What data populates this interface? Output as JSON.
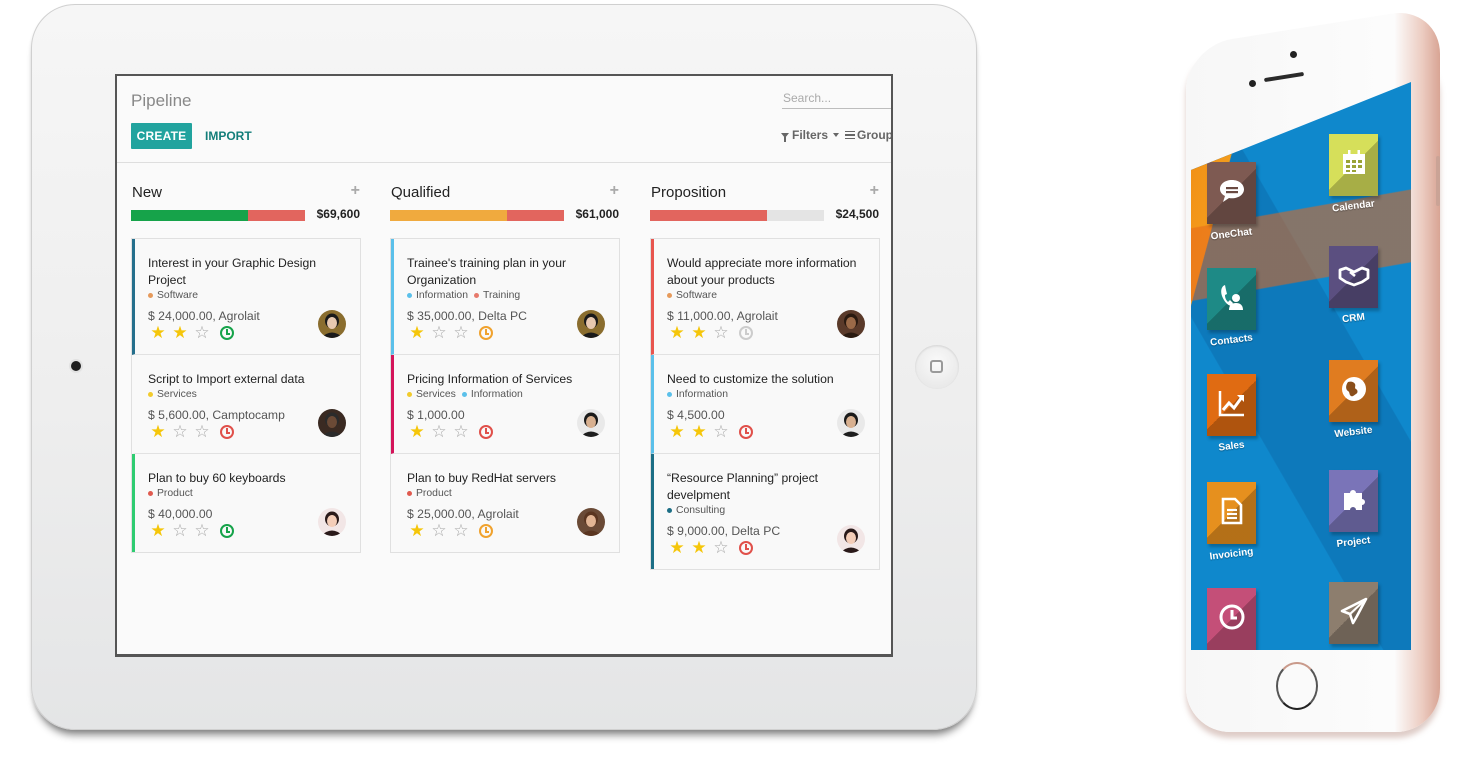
{
  "tablet": {
    "page_title": "Pipeline",
    "create_label": "CREATE",
    "import_label": "IMPORT",
    "search_placeholder": "Search...",
    "filters_label": "Filters",
    "group_label": "Group",
    "colors": {
      "accent": "#21a39e",
      "accent_dark": "#137e7a"
    },
    "columns": [
      {
        "title": "New",
        "total": "$69,600",
        "progress": [
          {
            "color": "#16a34a",
            "fraction": 0.67
          },
          {
            "color": "#e2655e",
            "fraction": 0.33
          }
        ],
        "cards": [
          {
            "title": "Interest in your Graphic Design Project",
            "tags": [
              {
                "label": "Software",
                "color": "#e69a5b"
              }
            ],
            "amount": "$ 24,000.00, Agrolait",
            "stars": 2,
            "activity_color": "#16a34a",
            "border_color": "#256f8c",
            "avatar": "woman-dark-hair"
          },
          {
            "title": "Script to Import external data",
            "tags": [
              {
                "label": "Services",
                "color": "#f2cb2c"
              }
            ],
            "amount": "$ 5,600.00, Camptocamp",
            "stars": 1,
            "activity_color": "#e0504a",
            "border_color": "transparent",
            "avatar": "man-bald"
          },
          {
            "title": "Plan to buy 60 keyboards",
            "tags": [
              {
                "label": "Product",
                "color": "#e05a4f"
              }
            ],
            "amount": "$ 40,000.00",
            "stars": 1,
            "activity_color": "#16a34a",
            "border_color": "#2ecc71",
            "avatar": "woman-cartoon"
          }
        ]
      },
      {
        "title": "Qualified",
        "total": "$61,000",
        "progress": [
          {
            "color": "#f0aa3e",
            "fraction": 0.67
          },
          {
            "color": "#e2655e",
            "fraction": 0.33
          }
        ],
        "cards": [
          {
            "title": "Trainee's training plan in your Organization",
            "tags": [
              {
                "label": "Information",
                "color": "#5bc0ea"
              },
              {
                "label": "Training",
                "color": "#e77a6c"
              }
            ],
            "amount": "$ 35,000.00, Delta PC",
            "stars": 1,
            "activity_color": "#f0a22e",
            "border_color": "#5bc0ea",
            "avatar": "woman-dark-hair"
          },
          {
            "title": "Pricing Information of Services",
            "tags": [
              {
                "label": "Services",
                "color": "#f2cb2c"
              },
              {
                "label": "Information",
                "color": "#5bc0ea"
              }
            ],
            "amount": "$ 1,000.00",
            "stars": 1,
            "activity_color": "#e0504a",
            "border_color": "#d4145a",
            "avatar": "man-suit"
          },
          {
            "title": "Plan to buy RedHat servers",
            "tags": [
              {
                "label": "Product",
                "color": "#e05a4f"
              }
            ],
            "amount": "$ 25,000.00, Agrolait",
            "stars": 1,
            "activity_color": "#f0a22e",
            "border_color": "transparent",
            "avatar": "woman-brown-hair"
          }
        ]
      },
      {
        "title": "Proposition",
        "total": "$24,500",
        "progress": [
          {
            "color": "#e2655e",
            "fraction": 0.67
          }
        ],
        "cards": [
          {
            "title": "Would appreciate more information about your products",
            "tags": [
              {
                "label": "Software",
                "color": "#e69a5b"
              }
            ],
            "amount": "$ 11,000.00, Agrolait",
            "stars": 2,
            "activity_color": "#cccccc",
            "border_color": "#e8554e",
            "avatar": "man-glasses"
          },
          {
            "title": "Need to customize the solution",
            "tags": [
              {
                "label": "Information",
                "color": "#5bc0ea"
              }
            ],
            "amount": "$ 4,500.00",
            "stars": 2,
            "activity_color": "#e0504a",
            "border_color": "#5bc0ea",
            "avatar": "man-suit"
          },
          {
            "title": "“Resource Planning” project develpment",
            "tags": [
              {
                "label": "Consulting",
                "color": "#1c6e85"
              }
            ],
            "amount": "$ 9,000.00, Delta PC",
            "stars": 2,
            "activity_color": "#e0504a",
            "border_color": "#1c6e85",
            "avatar": "woman-cartoon"
          }
        ]
      }
    ]
  },
  "phone": {
    "apps": [
      {
        "label": "OneChat",
        "color": "#7e5a52",
        "icon": "chat-icon"
      },
      {
        "label": "Calendar",
        "color": "#d6df5a",
        "icon": "calendar-icon"
      },
      {
        "label": "Contacts",
        "color": "#1e8a86",
        "icon": "contacts-icon"
      },
      {
        "label": "CRM",
        "color": "#5b4f80",
        "icon": "handshake-icon"
      },
      {
        "label": "Sales",
        "color": "#e06b12",
        "icon": "chart-up-icon"
      },
      {
        "label": "Website",
        "color": "#e07c20",
        "icon": "globe-icon"
      },
      {
        "label": "Invoicing",
        "color": "#e6901e",
        "icon": "document-icon"
      },
      {
        "label": "Project",
        "color": "#7a74b8",
        "icon": "puzzle-icon"
      },
      {
        "label": "",
        "color": "#c44f78",
        "icon": "clock-icon"
      },
      {
        "label": "",
        "color": "#8d7e6e",
        "icon": "paper-plane-icon"
      }
    ]
  }
}
